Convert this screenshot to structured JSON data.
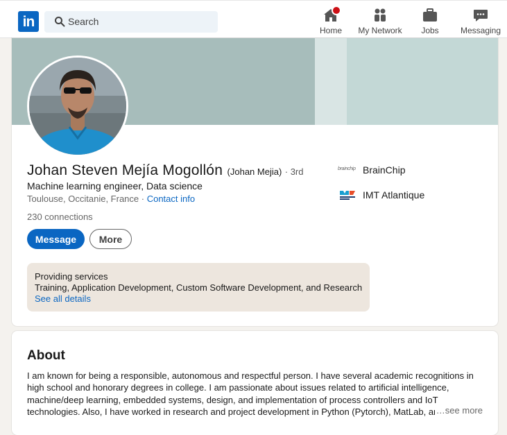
{
  "nav": {
    "logo_text": "in",
    "search_placeholder": "Search",
    "items": [
      {
        "label": "Home",
        "icon": "home-icon"
      },
      {
        "label": "My Network",
        "icon": "people-icon"
      },
      {
        "label": "Jobs",
        "icon": "briefcase-icon"
      },
      {
        "label": "Messaging",
        "icon": "chat-icon"
      }
    ]
  },
  "profile": {
    "name": "Johan Steven Mejía Mogollón",
    "alias": "(Johan Mejia)",
    "degree": "· 3rd",
    "headline": "Machine learning engineer, Data science",
    "location": "Toulouse, Occitanie, France",
    "location_sep": " · ",
    "contact_label": "Contact info",
    "connections": "230 connections",
    "message_label": "Message",
    "more_label": "More",
    "services": {
      "title": "Providing services",
      "description": "Training, Application Development, Custom Software Development, and Research",
      "link": "See all details"
    },
    "organizations": [
      {
        "name": "BrainChip",
        "logo_text": "brainchip"
      },
      {
        "name": "IMT Atlantique"
      }
    ]
  },
  "about": {
    "title": "About",
    "text": "I am known for being a responsible, autonomous and respectful person. I have several academic recognitions in high school and honorary degrees in college. I am passionate about issues related to artificial intelligence, machine/deep learning, embedded systems, design, and implementation of process controllers and IoT technologies. Also, I have worked in research and project development in Python (Pytorch), MatLab, and",
    "see_more": "…see more"
  },
  "colors": {
    "brand": "#0a66c2",
    "notification": "#cc1016",
    "services_bg": "#ede6de",
    "banner": "#a7bdbb"
  }
}
